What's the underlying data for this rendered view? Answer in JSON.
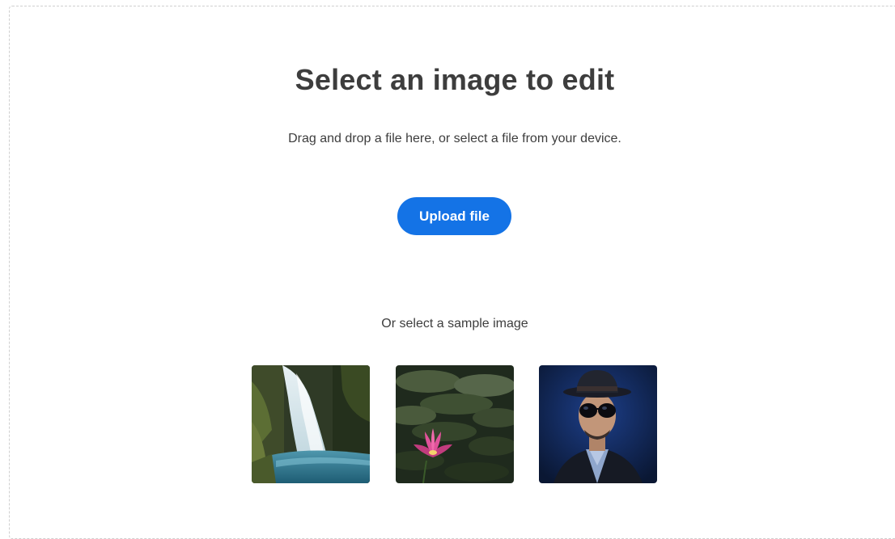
{
  "heading": "Select an image to edit",
  "instructions": "Drag and drop a file here, or select a file from your device.",
  "upload_button_label": "Upload file",
  "sample_section_label": "Or select a sample image",
  "sample_images": [
    {
      "name": "waterfall"
    },
    {
      "name": "pink-water-lily"
    },
    {
      "name": "man-with-hat-and-sunglasses"
    }
  ],
  "colors": {
    "primary_button": "#1473e6",
    "text": "#3d3d3d",
    "dropzone_border": "#cfcfcf"
  }
}
